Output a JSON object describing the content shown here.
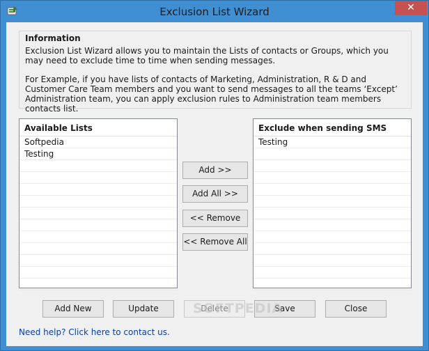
{
  "window": {
    "title": "Exclusion List Wizard",
    "close_glyph": "✕"
  },
  "info": {
    "heading": "Information",
    "paragraph1": "Exclusion List Wizard allows you to maintain the Lists of contacts or Groups, which you may need to exclude time to time when sending messages.",
    "paragraph2": "For Example, if you have lists of contacts of Marketing, Administration, R & D and Customer Care Team members and you want to send messages to all the teams ‘Except’ Administration team, you can apply exclusion rules to Administration team members contacts list."
  },
  "available_lists": {
    "header": "Available Lists",
    "items": [
      "Softpedia",
      "Testing"
    ]
  },
  "exclude_lists": {
    "header": "Exclude when sending SMS",
    "items": [
      "Testing"
    ]
  },
  "transfer_buttons": {
    "add": "Add >>",
    "add_all": "Add All >>",
    "remove": "<< Remove",
    "remove_all": "<< Remove All"
  },
  "action_buttons": {
    "add_new": "Add New",
    "update": "Update",
    "delete": "Delete",
    "save": "Save",
    "close": "Close"
  },
  "help_link": "Need help? Click here to contact us.",
  "watermark": "SOFTPEDIA",
  "colors": {
    "titlebar": "#3f8fd2",
    "close": "#c75050",
    "link": "#0a3ea8"
  }
}
